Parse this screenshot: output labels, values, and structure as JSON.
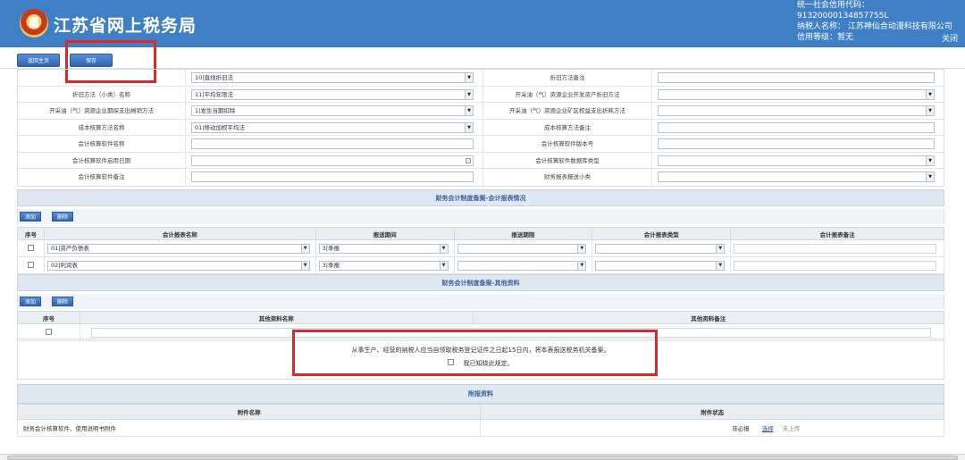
{
  "header": {
    "title": "江苏省网上税务局",
    "user_line1": "统一社会信用代码：91320000134857755L",
    "user_line2": "纳税人名称： 江苏神仙合动漫科技有限公司",
    "user_line3": "信用等级：暂无",
    "logout": "关闭"
  },
  "toolbar": {
    "home_label": "返回主页",
    "save_label": "保存"
  },
  "form_rows": [
    {
      "l1": "",
      "v1": "10|直线折旧法",
      "t1": "select",
      "l2": "折旧方法备注",
      "v2": "",
      "t2": "input"
    },
    {
      "l1": "折旧方法（小类）名称",
      "v1": "11|平均年限法",
      "t1": "select",
      "l2": "开采油（气）资源企业开发资产折旧方法",
      "v2": "",
      "t2": "select"
    },
    {
      "l1": "开采油（气）资源企业期探支出摊销方法",
      "v1": "1|发生当期扣除",
      "t1": "select",
      "l2": "开采油（气）资源企业矿区权益支出折耗方法",
      "v2": "",
      "t2": "select"
    },
    {
      "l1": "成本核算方法名称",
      "v1": "01|移动加权平均法",
      "t1": "select",
      "l2": "成本核算方法备注",
      "v2": "",
      "t2": "input"
    },
    {
      "l1": "会计核算软件名称",
      "v1": "",
      "t1": "input",
      "l2": "会计核算软件版本号",
      "v2": "",
      "t2": "input"
    },
    {
      "l1": "会计核算软件启用日期",
      "v1": "",
      "t1": "date",
      "l2": "会计核算软件数据库类型",
      "v2": "",
      "t2": "select"
    },
    {
      "l1": "会计核算软件备注",
      "v1": "",
      "t1": "input",
      "l2": "财务报表报送小类",
      "v2": "",
      "t2": "select"
    }
  ],
  "report_section": {
    "title": "财务会计制度备案-会计报表情况",
    "add": "添加",
    "delete": "删除",
    "headers": [
      "序号",
      "会计报表名称",
      "报送期间",
      "报送期限",
      "会计报表类型",
      "会计报表备注"
    ],
    "rows": [
      {
        "name": "01|资产负债表",
        "period": "3|季报"
      },
      {
        "name": "02|利润表",
        "period": "3|季报"
      }
    ]
  },
  "other_section": {
    "title": "财务会计制度备案-其他资料",
    "add": "添加",
    "delete": "删除",
    "headers": [
      "序号",
      "其他资料名称",
      "其他资料备注"
    ]
  },
  "notice": {
    "text": "从事生产、经营的纳税人应当自领取税务登记证件之日起15日内，将本表报送税务机关备案。",
    "ack": "我已知晓此规定。"
  },
  "attachments": {
    "title": "附报资料",
    "headers": [
      "附件名称",
      "附件状态"
    ],
    "row_name": "财务会计核算软件、使用说明书附件",
    "required": "非必报",
    "select": "选择",
    "status": "未上传"
  },
  "colors": {
    "header_bg": "#3e7fc6",
    "highlight": "#d92a2a",
    "section_bg": "#dfe7f1"
  }
}
